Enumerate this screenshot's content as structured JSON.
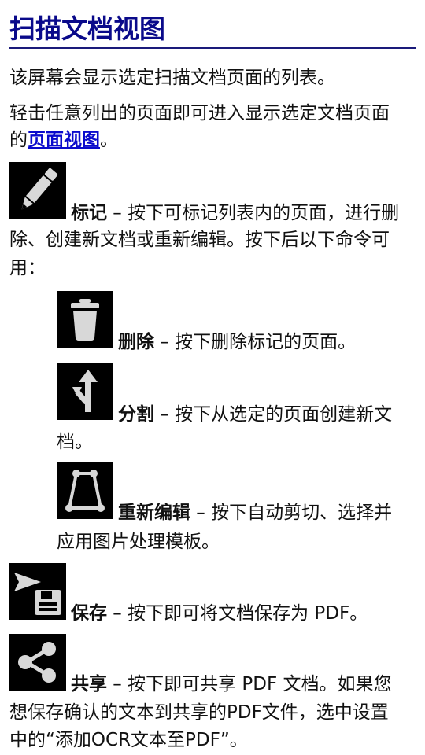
{
  "title": "扫描文档视图",
  "intro": "该屏幕会显示选定扫描文档页面的列表。",
  "tap": {
    "line1": "轻击任意列出的页面即可进入显示选定文档页面",
    "prefix": "的",
    "link": "页面视图",
    "suffix": "。"
  },
  "mark": {
    "icon": "pencil-icon",
    "name": "标记",
    "desc1": " – 按下可标记列表内的页面，进行删",
    "desc2": "除、创建新文档或重新编辑。按下后以下命令可",
    "desc3": "用："
  },
  "delete": {
    "icon": "trash-icon",
    "name": "删除",
    "desc1": " – 按下删除标记的页面。"
  },
  "split": {
    "icon": "split-arrow-icon",
    "name": "分割",
    "desc1": " – 按下从选定的页面创建新文",
    "desc2": "档。"
  },
  "reedit": {
    "icon": "crop-quad-icon",
    "name": "重新编辑",
    "desc1": " – 按下自动剪切、选择并",
    "desc2": "应用图片处理模板。"
  },
  "save": {
    "icon": "save-send-icon",
    "name": "保存",
    "desc1": " – 按下即可将文档保存为 PDF。"
  },
  "share": {
    "icon": "share-icon",
    "name": "共享",
    "desc1": " – 按下即可共享 PDF 文档。如果您",
    "desc2": "想保存确认的文本到共享的PDF文件，选中设置",
    "desc3": "中的“添加OCR文本至PDF”。"
  }
}
